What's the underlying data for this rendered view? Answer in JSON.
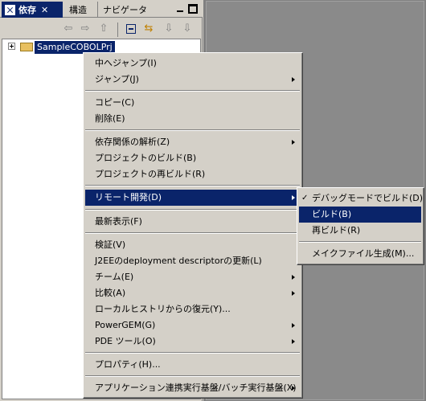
{
  "tabs": {
    "active": "依存",
    "close": "✕",
    "structure": "構造",
    "navigator": "ナビゲータ"
  },
  "icons": [
    "view-menu-icon",
    "close-icon",
    "back-arrow-icon",
    "forward-arrow-icon",
    "up-folder-icon",
    "collapse-all-icon",
    "link-editor-icon",
    "pin-icon",
    "pin-icon",
    "expand-icon",
    "project-folder-icon"
  ],
  "tree": {
    "project": "SampleCOBOLPrj"
  },
  "context_menu": {
    "items": [
      {
        "label": "中へジャンプ(I)"
      },
      {
        "label": "ジャンプ(J)",
        "submenu": true
      },
      {
        "label": "コピー(C)"
      },
      {
        "label": "削除(E)"
      },
      {
        "label": "依存関係の解析(Z)",
        "submenu": true
      },
      {
        "label": "プロジェクトのビルド(B)"
      },
      {
        "label": "プロジェクトの再ビルド(R)"
      },
      {
        "label": "リモート開発(D)",
        "submenu": true,
        "selected": true
      },
      {
        "label": "最新表示(F)"
      },
      {
        "label": "検証(V)"
      },
      {
        "label": "J2EEのdeployment descriptorの更新(L)"
      },
      {
        "label": "チーム(E)",
        "submenu": true
      },
      {
        "label": "比較(A)",
        "submenu": true
      },
      {
        "label": "ローカルヒストリからの復元(Y)..."
      },
      {
        "label": "PowerGEM(G)",
        "submenu": true
      },
      {
        "label": "PDE ツール(O)",
        "submenu": true
      },
      {
        "label": "プロパティ(H)..."
      },
      {
        "label": "アプリケーション連携実行基盤/バッチ実行基盤(X)",
        "submenu": true
      }
    ]
  },
  "submenu": {
    "items": [
      {
        "label": "デバッグモードでビルド(D)",
        "checked": true
      },
      {
        "label": "ビルド(B)",
        "selected": true
      },
      {
        "label": "再ビルド(R)"
      },
      {
        "label": "メイクファイル生成(M)..."
      }
    ]
  },
  "colors": {
    "face": "#d4d0c8",
    "highlight": "#0a246a",
    "editor_bg": "#808080"
  }
}
